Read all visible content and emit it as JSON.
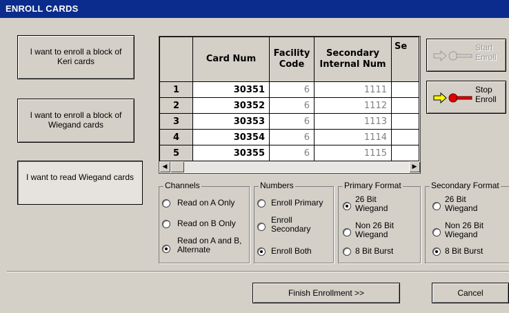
{
  "window": {
    "title": "ENROLL CARDS"
  },
  "left_buttons": [
    {
      "label": "I want to enroll a block of Keri cards"
    },
    {
      "label": "I want to enroll a block of Wiegand cards"
    },
    {
      "label": "I want to read Wiegand cards"
    }
  ],
  "grid": {
    "headers": [
      "Card Num",
      "Facility Code",
      "Secondary Internal Num",
      "Se"
    ],
    "rows": [
      {
        "n": "1",
        "card": "30351",
        "facility": "6",
        "secondary": "1111"
      },
      {
        "n": "2",
        "card": "30352",
        "facility": "6",
        "secondary": "1112"
      },
      {
        "n": "3",
        "card": "30353",
        "facility": "6",
        "secondary": "1113"
      },
      {
        "n": "4",
        "card": "30354",
        "facility": "6",
        "secondary": "1114"
      },
      {
        "n": "5",
        "card": "30355",
        "facility": "6",
        "secondary": "1115"
      }
    ]
  },
  "right_buttons": {
    "start": {
      "line1": "Start",
      "line2": "Enroll",
      "enabled": false
    },
    "stop": {
      "line1": "Stop",
      "line2": "Enroll",
      "enabled": true
    }
  },
  "groups": {
    "channels": {
      "title": "Channels",
      "options": [
        "Read on A Only",
        "Read on B Only",
        "Read on A and B, Alternate"
      ],
      "selected": 2
    },
    "numbers": {
      "title": "Numbers",
      "options": [
        "Enroll Primary",
        "Enroll Secondary",
        "Enroll Both"
      ],
      "selected": 2
    },
    "primary_format": {
      "title": "Primary Format",
      "options": [
        "26 Bit Wiegand",
        "Non 26 Bit Wiegand",
        "8 Bit Burst"
      ],
      "selected": 0
    },
    "secondary_format": {
      "title": "Secondary Format",
      "options": [
        "26 Bit Wiegand",
        "Non 26 Bit Wiegand",
        "8 Bit Burst"
      ],
      "selected": 2
    }
  },
  "bottom": {
    "finish": "Finish Enrollment >>",
    "cancel": "Cancel"
  },
  "colors": {
    "titlebar": "#0b2c8c",
    "face": "#d4d0c8",
    "key_yellow": "#ffff00",
    "key_red": "#e00000"
  },
  "icons": {
    "start": "arrow-key-icon",
    "stop": "arrow-key-icon"
  }
}
